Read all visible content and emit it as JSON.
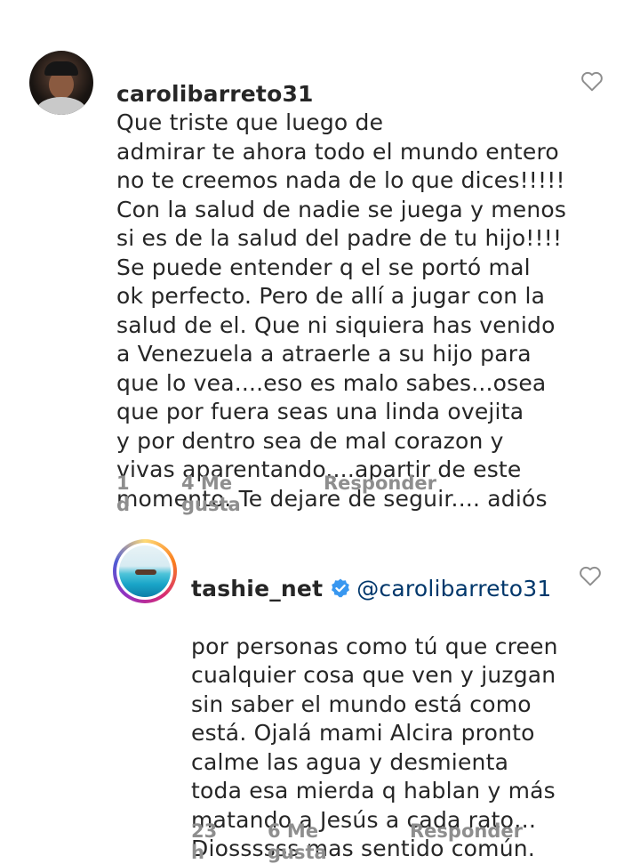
{
  "comments": [
    {
      "username": "carolibarreto31",
      "text": "Que triste que luego de\nadmirar te ahora todo el mundo entero\nno te creemos nada de lo que dices!!!!!\nCon la salud de nadie se juega y menos\nsi es de la salud del padre de tu hijo!!!!\nSe puede entender q el se portó mal\nok perfecto. Pero de allí a jugar con la\nsalud de el.  Que ni siquiera has venido\na Venezuela a atraerle a su hijo para\nque lo vea....eso es malo sabes...osea\nque por fuera seas una linda ovejita\ny por dentro sea de mal corazon y\nvivas aparentando....apartir de este\nmomento. Te dejare de seguir.... adiós",
      "time": "1 d",
      "likes": "4 Me gusta",
      "reply": "Responder"
    },
    {
      "username": "tashie_net",
      "mention": "@carolibarreto31",
      "text": "por personas como tú que creen\ncualquier cosa que ven y juzgan\nsin saber el mundo está como\nestá. Ojalá mami Alcira pronto\ncalme las agua y desmienta\ntoda esa mierda q hablan y más\nmatando a Jesús a cada rato…\nDiossssss mas sentido común.",
      "time": "23 h",
      "likes": "6 Me gusta",
      "reply": "Responder"
    }
  ],
  "colors": {
    "text": "#262626",
    "meta": "#8e8e8e",
    "mention": "#00376b",
    "verified": "#3897f0"
  },
  "icons": {
    "like": "heart-outline-icon",
    "verified": "verified-badge-icon"
  }
}
